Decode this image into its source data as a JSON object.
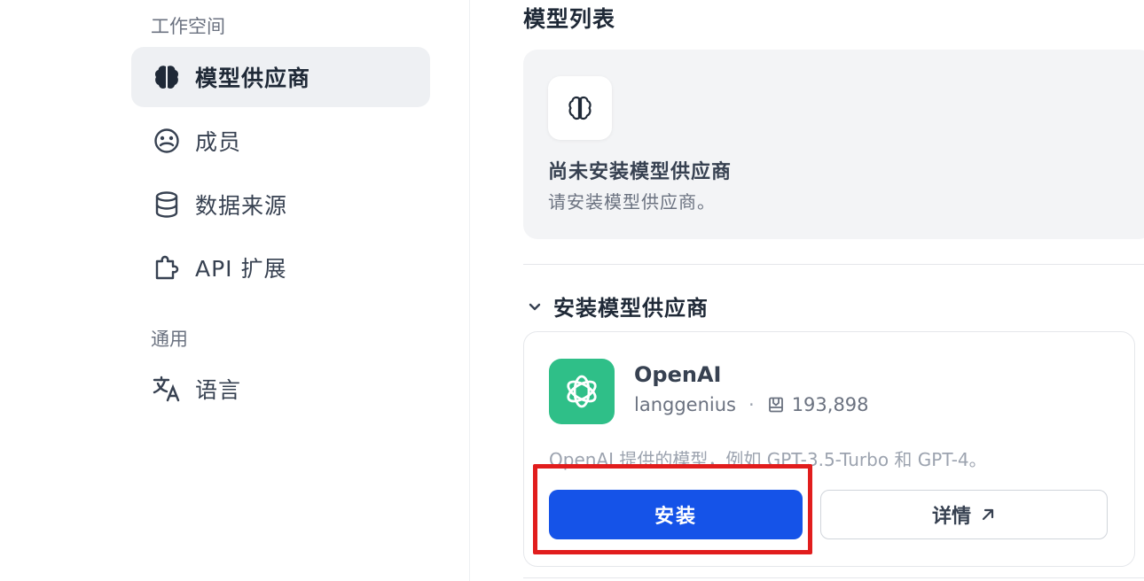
{
  "sidebar": {
    "workspace_label": "工作空间",
    "general_label": "通用",
    "items": [
      {
        "label": "模型供应商",
        "icon": "brain-icon",
        "active": true
      },
      {
        "label": "成员",
        "icon": "members-icon",
        "active": false
      },
      {
        "label": "数据来源",
        "icon": "database-icon",
        "active": false
      },
      {
        "label": "API 扩展",
        "icon": "puzzle-icon",
        "active": false
      }
    ],
    "general_items": [
      {
        "label": "语言",
        "icon": "translate-icon"
      }
    ]
  },
  "main": {
    "title": "模型列表",
    "empty_state": {
      "icon": "brain-icon",
      "title": "尚未安装模型供应商",
      "desc": "请安装模型供应商。"
    },
    "install_section": {
      "header": "安装模型供应商",
      "provider": {
        "name": "OpenAI",
        "author": "langgenius",
        "separator": "·",
        "downloads": "193,898",
        "desc": "OpenAI 提供的模型，例如 GPT-3.5-Turbo 和 GPT-4。",
        "install_label": "安装",
        "detail_label": "详情",
        "logo_color": "#2fbf88"
      }
    }
  },
  "colors": {
    "primary": "#1553e8",
    "highlight": "#e11d1d",
    "active_bg": "#eef0f3"
  }
}
